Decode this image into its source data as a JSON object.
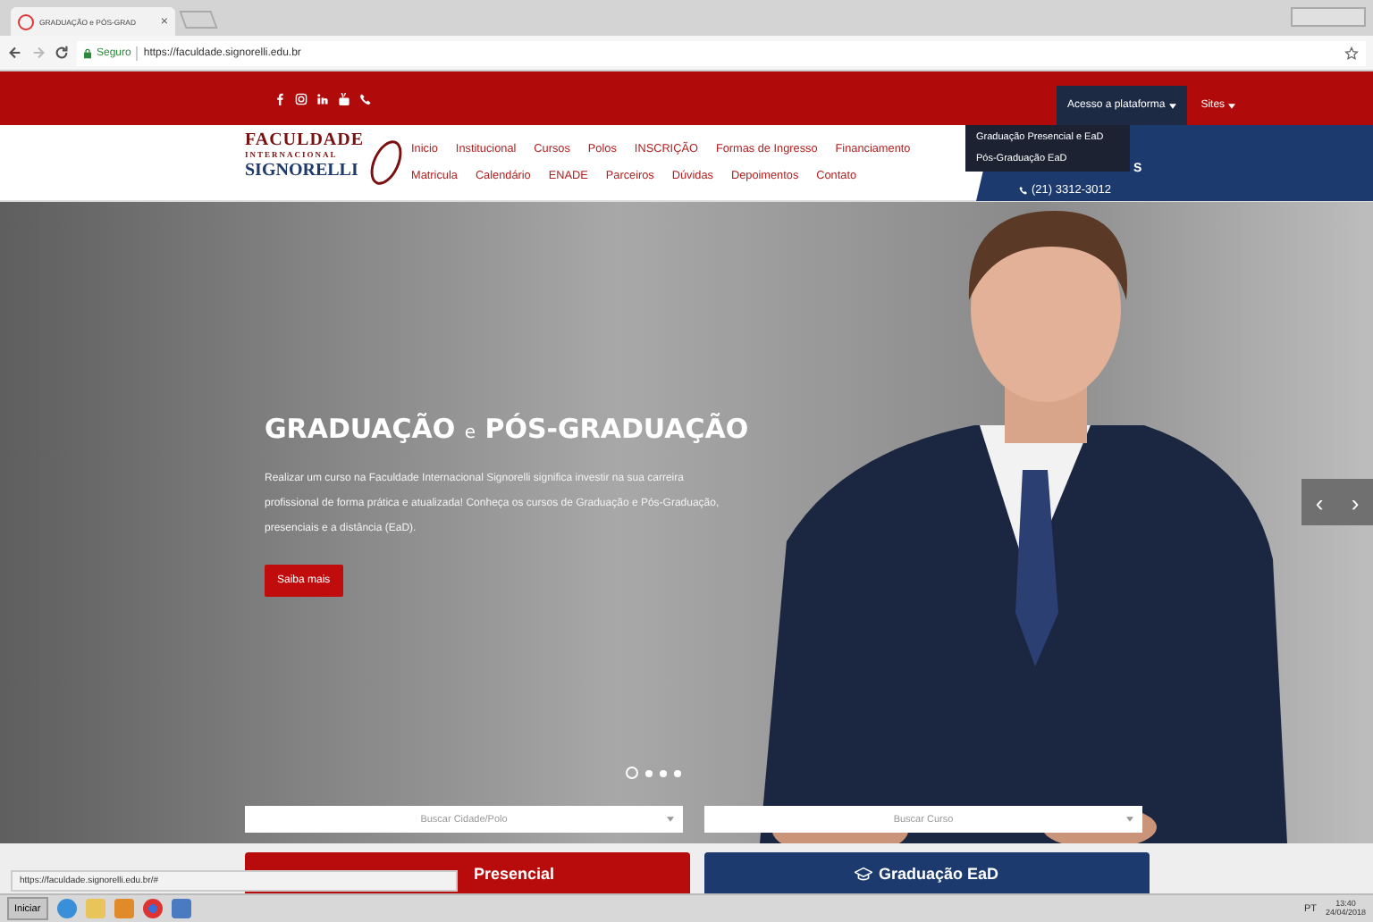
{
  "browser": {
    "tab": {
      "title": "GRADUAÇÃO e PÓS-GRAD",
      "close": "×"
    },
    "address": {
      "secure_label": "Seguro",
      "url": "https://faculdade.signorelli.edu.br"
    }
  },
  "topbar": {
    "menus": [
      {
        "label": "Acesso a plataforma",
        "selected": true
      },
      {
        "label": "Sites",
        "selected": false
      }
    ],
    "dropdown": [
      "Graduação Presencial e EaD",
      "Pós-Graduação EaD"
    ]
  },
  "logo": {
    "line1": "FACULDADE",
    "line2": "INTERNACIONAL",
    "line3": "SIGNORELLI"
  },
  "nav": {
    "row1": [
      "Inicio",
      "Institucional",
      "Cursos",
      "Polos",
      "INSCRIÇÃO",
      "Formas de Ingresso",
      "Financiamento"
    ],
    "row2": [
      "Matricula",
      "Calendário",
      "ENADE",
      "Parceiros",
      "Dúvidas",
      "Depoimentos",
      "Contato"
    ]
  },
  "contact": {
    "label": "S",
    "phone": "(21) 3312-3012"
  },
  "hero": {
    "title_a": "GRADUAÇÃO",
    "title_join": "e",
    "title_b": "PÓS-GRADUAÇÃO",
    "text": "Realizar um curso na Faculdade Internacional Signorelli significa investir na sua carreira profissional de forma prática e atualizada! Conheça os cursos de Graduação e Pós-Graduação, presenciais e a distância (EaD).",
    "button": "Saiba mais",
    "slides": [
      {
        "selected": true
      },
      {
        "selected": false
      },
      {
        "selected": false
      },
      {
        "selected": false
      }
    ],
    "prev": "‹",
    "next": "›"
  },
  "search": [
    {
      "placeholder": "Buscar Cidade/Polo"
    },
    {
      "placeholder": "Buscar Curso"
    }
  ],
  "cards": [
    {
      "label": "Presencial",
      "color": "#b80c0c"
    },
    {
      "label": "Graduação EaD",
      "color": "#1c3a6e"
    }
  ],
  "status_url": "https://faculdade.signorelli.edu.br/#",
  "taskbar": {
    "start": "Iniciar",
    "language": "PT",
    "time": "13:40",
    "date": "24/04/2018"
  }
}
